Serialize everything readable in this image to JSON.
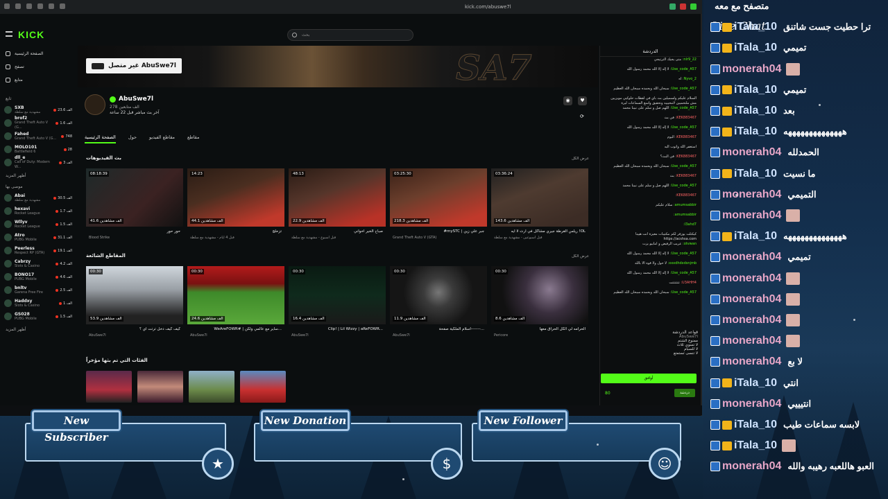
{
  "browser": {
    "address": "kick.com/abuswe7l"
  },
  "site": {
    "logo": "KICK",
    "search_placeholder": "بحث",
    "nav": [
      "الصفحة الرئيسية",
      "تصفح",
      "متابع"
    ],
    "section_live": "ثابع",
    "channels": [
      {
        "name": "SXB",
        "game": "مشهدية مع سلطة",
        "viewers": "23.6 الف"
      },
      {
        "name": "brof2",
        "game": "Grand Theft Auto V (G...",
        "viewers": "1.6 الف"
      },
      {
        "name": "Fahed",
        "game": "Grand Theft Auto V (G...",
        "viewers": "748"
      },
      {
        "name": "MOLO101",
        "game": "Battlefield 6",
        "viewers": "28"
      },
      {
        "name": "dll_e",
        "game": "Call of Duty: Modern W...",
        "viewers": "3 الف"
      }
    ],
    "show_more": "أظهر المزيد",
    "section_recommended": "موصى بها",
    "recommended": [
      {
        "name": "Abai",
        "game": "مشهدية مع سلطة",
        "viewers": "30.5 الف"
      },
      {
        "name": "hexavi",
        "game": "Rocket League",
        "viewers": "1.7 الف"
      },
      {
        "name": "Wllyv",
        "game": "Rocket League",
        "viewers": "1.5 الف"
      },
      {
        "name": "Atro",
        "game": "PUBG Mobile",
        "viewers": "31.1 الف"
      },
      {
        "name": "Peerless",
        "game": "Respect RP (GTA)",
        "viewers": "19.1 الف"
      },
      {
        "name": "Cabrzy",
        "game": "Slots & Casino",
        "viewers": "4.2 الف"
      },
      {
        "name": "BONO17",
        "game": "PUBG Mobile",
        "viewers": "4.6 الف"
      },
      {
        "name": "bnltv",
        "game": "Garena Free Fire",
        "viewers": "2.5 الف"
      },
      {
        "name": "Haddxy",
        "game": "Slots & Casino",
        "viewers": "1 الف"
      },
      {
        "name": "GS028",
        "game": "PUBG Mobile",
        "viewers": "1.5 الف"
      }
    ],
    "show_more_2": "أظهر المزيد"
  },
  "channel": {
    "offline_label": "غير متصل AbuSwe7l",
    "banner_logo": "SA7",
    "name": "AbuSwe7l",
    "followers": "278 الف متابعين",
    "last_live": "آخر بث مباشر قبل 22 ساعة",
    "tabs": [
      "الصفحة الرئيسية",
      "حول",
      "مقاطع الفيديو",
      "مقاطع"
    ],
    "vods_title": "بث الفيديوهات",
    "show_all": "عرض الكل",
    "vods": [
      {
        "dur": "08:18:39",
        "views": "41.6 الف مشاهدين",
        "title": "حور حور",
        "sub": "Blood Strike"
      },
      {
        "dur": "14:23",
        "views": "44.1 الف مشاهدين",
        "title": "تزحلج",
        "sub": "قبل 4 ايام - مشهدية مع سلطة"
      },
      {
        "dur": "48:13",
        "views": "22.9 الف مشاهدين",
        "title": "صباح الخير اخواني",
        "sub": "قبل اسبوع - مشهدية مع سلطة"
      },
      {
        "dur": "03:25:30",
        "views": "218.3 الف مشاهدين",
        "title": "#mySTC | جبر علي زين",
        "sub": "Grand Theft Auto V (GTA)"
      },
      {
        "dur": "03:36:24",
        "views": "143.6 الف مشاهدين",
        "title": "ريلس القرطة جيري مشاكل في ارت لا ايه !OL",
        "sub": "قبل اسبوعين - مشهدية مع سلطة"
      }
    ],
    "clips_title": "المقاطع الشائعة",
    "show_all_2": "عرض الكل",
    "clips": [
      {
        "dur": "00:30",
        "views": "53.9 الف مشاهدين",
        "title": "كيف كيف دخل ترتت اي ؟",
        "by": "AbuSwe7l"
      },
      {
        "dur": "00:30",
        "views": "24.6 الف مشاهدين",
        "title": "WeAreFOWR# | ساير مع عالمي ولكن...",
        "by": "AbuSwe7l"
      },
      {
        "dur": "00:30",
        "views": "16.4 الف مشاهدين",
        "title": "Clip! | Lil Wizzy | aReFOWR...",
        "by": "AbuSwe7l"
      },
      {
        "dur": "00:30",
        "views": "11.9 الف مشاهدين",
        "title": "اسلام الملكية صفحة-------...",
        "by": "AbuSwe7l"
      },
      {
        "dur": "00:30",
        "views": "8.6 الف مشاهدين",
        "title": "الحرامه لي الكل الحراق معها",
        "by": "Pericore"
      }
    ],
    "cats_title": "الفئات التي تم بثها مؤخراً"
  },
  "chat": {
    "title": "الدردشة",
    "messages": [
      {
        "user": "nlr9_22:",
        "text": "متى يجيك الترتيجي",
        "red": false
      },
      {
        "user": "Use_code_A57:",
        "text": "لا إله إلا الله محمد رسول الله",
        "red": false
      },
      {
        "user": "Nyvo_2:",
        "text": "اه",
        "red": false
      },
      {
        "user": "Use_code_A57:",
        "text": "سبحان الله وبحمده سبحان الله العظيم",
        "red": false
      },
      {
        "user": "",
        "text": "السلام عليكم ولسميلين بث باي في لقطات حلوكيي مويزيين مش ملتحميين لامحيييه وتحقيق واسع السماعات ليرة",
        "red": false
      },
      {
        "user": "Use_code_A57:",
        "text": "اللهم صل و سلم على نبينا محمد",
        "red": false
      },
      {
        "user": "KEK883467:",
        "text": "في بث",
        "red": true
      },
      {
        "user": "Use_code_A57:",
        "text": "لا إله إلا الله محمد رسول الله",
        "red": false
      },
      {
        "user": "KEK883467:",
        "text": "اليوم",
        "red": true
      },
      {
        "user": "",
        "text": "استغفر الله واتوب اليه",
        "red": false
      },
      {
        "user": "KEK883467:",
        "text": "في البث؟",
        "red": true
      },
      {
        "user": "Use_code_A57:",
        "text": "سبحان الله وبحمده سبحان الله العظيم",
        "red": false
      },
      {
        "user": "KEK883467:",
        "text": "بث",
        "red": true
      },
      {
        "user": "Use_code_A57:",
        "text": "اللهم صل و سلم على نبينا محمد",
        "red": false
      },
      {
        "user": "KEK883467:",
        "text": "",
        "red": true
      },
      {
        "user": "amumsabbir:",
        "text": "سلام عليكم",
        "red": false
      },
      {
        "user": "amumsabbir:",
        "text": "",
        "red": false
      },
      {
        "user": "l3ahd7:",
        "text": "",
        "red": false
      },
      {
        "user": "",
        "text": "كيكتلت يوزفر لكم مكتيبات معيزة انت هيينا https://acshsa.com",
        "red": false
      },
      {
        "user": "otvwan:",
        "text": "عريب الرفيض و امابيو يزت",
        "red": false
      },
      {
        "user": "Use_code_A57:",
        "text": "لا إله إلا الله محمد رسول الله",
        "red": false
      },
      {
        "user": "xxxdhdxdsnjmb:",
        "text": "لا حول ولا قوه الا بالله",
        "red": false
      },
      {
        "user": "Use_code_A57:",
        "text": "لا إله إلا الله محمد رسول الله",
        "red": false
      },
      {
        "user": "U3AHH4:",
        "text": "تتتتتتتت",
        "red": true
      },
      {
        "user": "Use_code_A57:",
        "text": "سبحان الله وبحمده سبحان الله العظيم",
        "red": false
      }
    ],
    "rules_title": "قواعد الدردشة",
    "rules_owner": "AbuSwe7l",
    "rules": [
      "ممنوع الشتم",
      "لا تسوي ثلاث",
      "لا للسبام",
      "لا تنسى تستمتع"
    ],
    "accept_label": "أوافق",
    "points": "80",
    "send_label": "دردشة"
  },
  "overlay": {
    "subscriber_label": "New Subscriber",
    "donation_label": "New Donation",
    "follower_label": "New Follower",
    "livechat_title": "Live Chat",
    "livechat": [
      {
        "user": "",
        "text": "متصفح مع معه",
        "kind": "partial"
      },
      {
        "user": "iTala_10",
        "text": "ترا حطيت جست شاتنق",
        "kind": "it"
      },
      {
        "user": "iTala_10",
        "text": "تميمي",
        "kind": "it"
      },
      {
        "user": "monerah04",
        "text": "",
        "kind": "mo"
      },
      {
        "user": "iTala_10",
        "text": "تميمي",
        "kind": "it"
      },
      {
        "user": "iTala_10",
        "text": "بعد",
        "kind": "it"
      },
      {
        "user": "iTala_10",
        "text": "ههههههههههههههه",
        "kind": "it"
      },
      {
        "user": "monerah04",
        "text": "الحمدلله",
        "kind": "mo"
      },
      {
        "user": "iTala_10",
        "text": "ما نسيت",
        "kind": "it"
      },
      {
        "user": "monerah04",
        "text": "التميمي",
        "kind": "mo"
      },
      {
        "user": "monerah04",
        "text": "",
        "kind": "mo"
      },
      {
        "user": "iTala_10",
        "text": "ههههههههههههههه",
        "kind": "it"
      },
      {
        "user": "monerah04",
        "text": "تميمي",
        "kind": "mo"
      },
      {
        "user": "monerah04",
        "text": "",
        "kind": "mo"
      },
      {
        "user": "monerah04",
        "text": "",
        "kind": "mo"
      },
      {
        "user": "monerah04",
        "text": "",
        "kind": "mo"
      },
      {
        "user": "monerah04",
        "text": "",
        "kind": "mo"
      },
      {
        "user": "monerah04",
        "text": "لا بع",
        "kind": "mo"
      },
      {
        "user": "iTala_10",
        "text": "انتي",
        "kind": "it"
      },
      {
        "user": "monerah04",
        "text": "انتيييي",
        "kind": "mo"
      },
      {
        "user": "iTala_10",
        "text": "لابسه سماعات طيب",
        "kind": "it"
      },
      {
        "user": "iTala_10",
        "text": "",
        "kind": "it"
      },
      {
        "user": "monerah04",
        "text": "العبو هاللعبه رهيبه والله",
        "kind": "mo"
      }
    ]
  }
}
